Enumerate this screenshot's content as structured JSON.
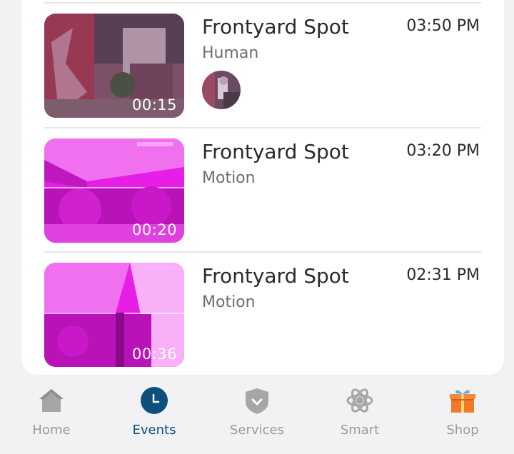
{
  "events": [
    {
      "camera": "Frontyard Spot",
      "type": "Human",
      "time": "03:50 PM",
      "duration": "00:15",
      "has_face": true,
      "tint": "#8a2a6a"
    },
    {
      "camera": "Frontyard Spot",
      "type": "Motion",
      "time": "03:20 PM",
      "duration": "00:20",
      "has_face": false,
      "tint": "#e61ee6"
    },
    {
      "camera": "Frontyard Spot",
      "type": "Motion",
      "time": "02:31 PM",
      "duration": "00:36",
      "has_face": false,
      "tint": "#e61ee6"
    }
  ],
  "tabbar": {
    "active": "Events",
    "tabs": [
      {
        "label": "Home",
        "icon": "home-icon"
      },
      {
        "label": "Events",
        "icon": "clock-icon"
      },
      {
        "label": "Services",
        "icon": "shield-icon"
      },
      {
        "label": "Smart",
        "icon": "smart-icon"
      },
      {
        "label": "Shop",
        "icon": "gift-icon"
      }
    ]
  },
  "colors": {
    "accent": "#0e4f7c",
    "inactive": "#9a9a9a",
    "shop_gift": "#f07a2a",
    "divider": "#e6e6e8"
  }
}
